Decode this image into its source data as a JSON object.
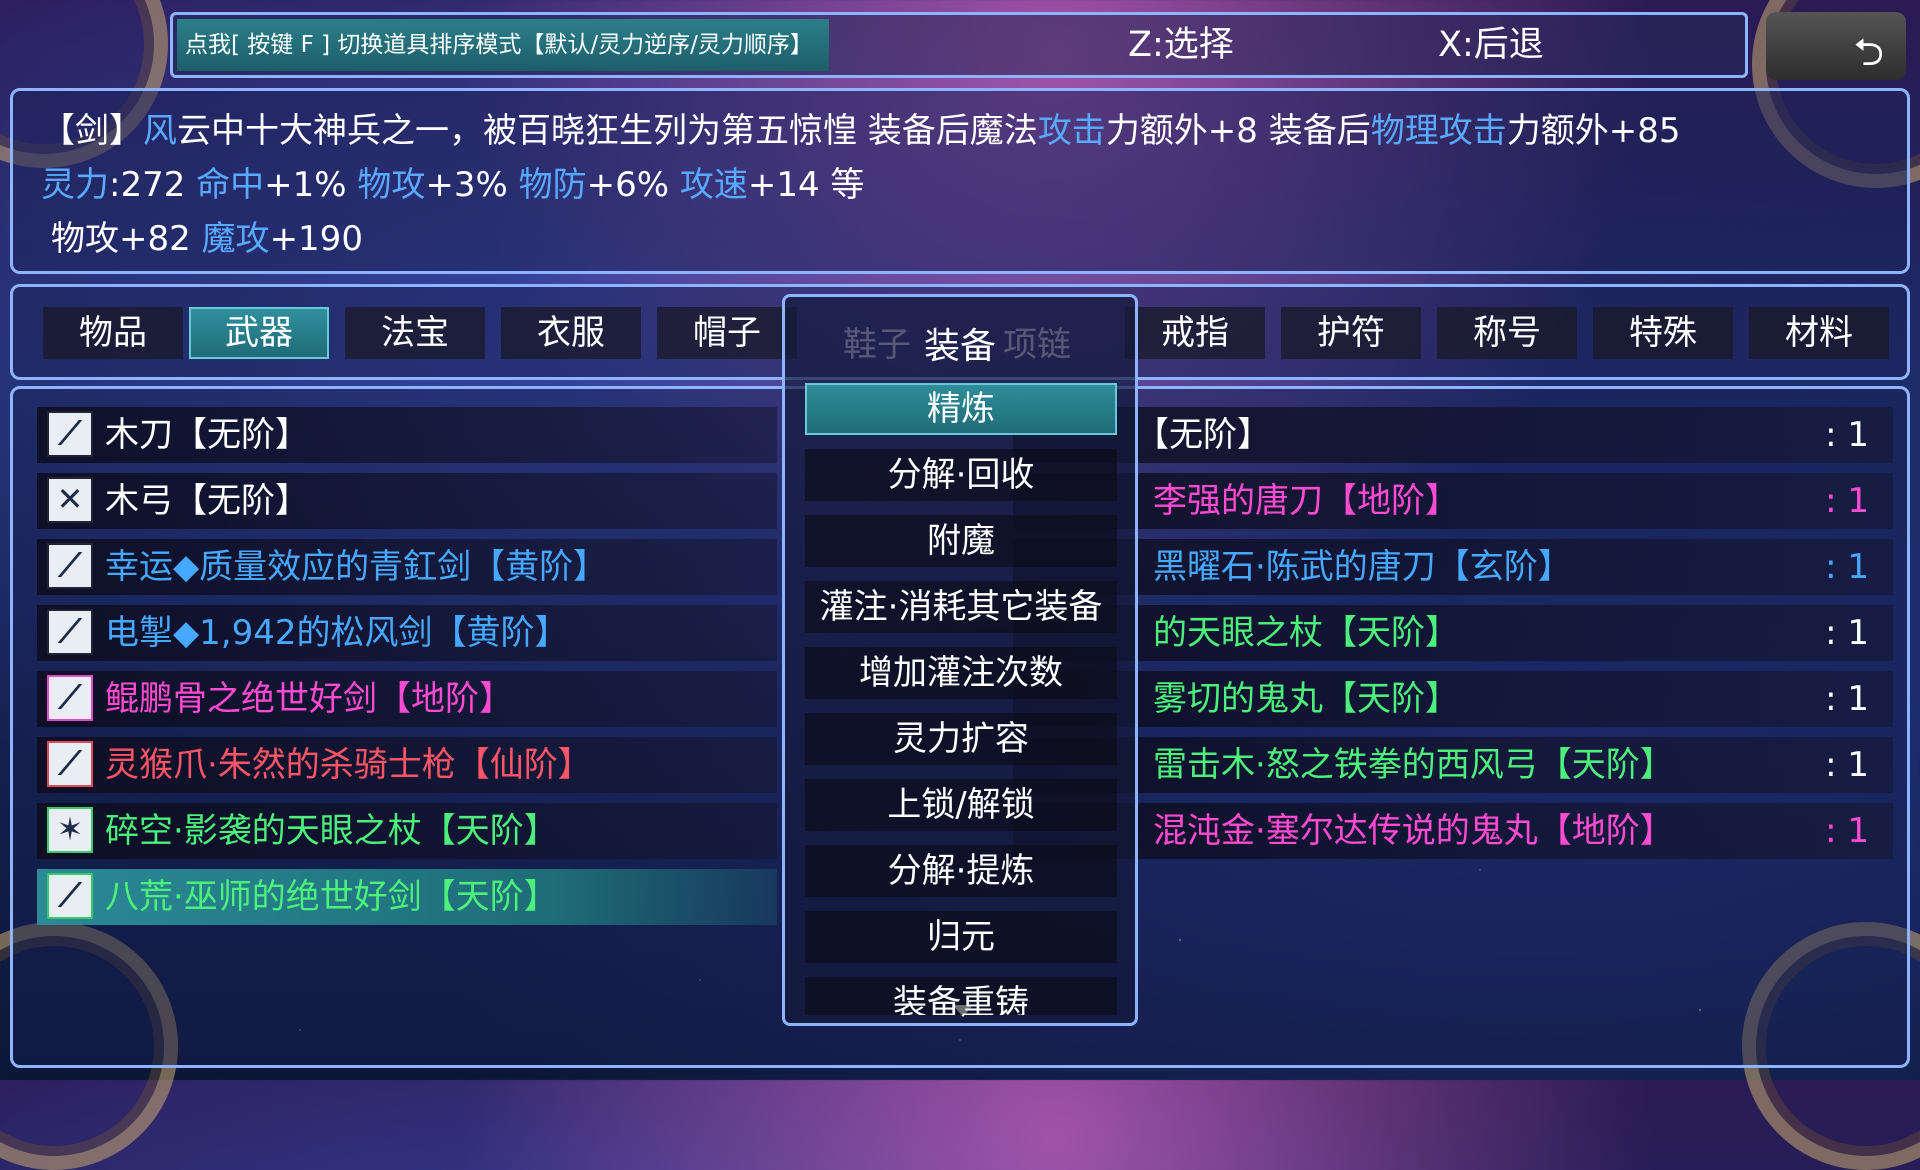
{
  "topbar": {
    "sort_button": "点我[ 按键 F ] 切换道具排序模式【默认/灵力逆序/灵力顺序】",
    "hint_select": "Z:选择",
    "hint_back": "X:后退"
  },
  "back_button_icon": "undo-arrow-icon",
  "description": {
    "line1": [
      {
        "text": "【剑】",
        "c": "white"
      },
      {
        "text": "风",
        "c": "blue"
      },
      {
        "text": "云中十大神兵之一，被百晓狂生列为第五惊惶 装备后魔法",
        "c": "white"
      },
      {
        "text": "攻击",
        "c": "blue"
      },
      {
        "text": "力额外+8 装备后",
        "c": "white"
      },
      {
        "text": "物理攻击",
        "c": "blue"
      },
      {
        "text": "力额外+85",
        "c": "white"
      }
    ],
    "line2": [
      {
        "text": "灵力",
        "c": "blue"
      },
      {
        "text": ":272 ",
        "c": "white"
      },
      {
        "text": "命中",
        "c": "blue"
      },
      {
        "text": "+1% ",
        "c": "white"
      },
      {
        "text": "物攻",
        "c": "blue"
      },
      {
        "text": "+3% ",
        "c": "white"
      },
      {
        "text": "物防",
        "c": "blue"
      },
      {
        "text": "+6% ",
        "c": "white"
      },
      {
        "text": "攻速",
        "c": "blue"
      },
      {
        "text": "+14 等",
        "c": "white"
      }
    ],
    "line3": [
      {
        "text": "物攻+82 ",
        "c": "white"
      },
      {
        "text": "魔攻",
        "c": "blue"
      },
      {
        "text": "+190",
        "c": "white"
      }
    ]
  },
  "tabs": [
    "物品",
    "武器",
    "法宝",
    "衣服",
    "帽子",
    "鞋子",
    "项链",
    "戒指",
    "护符",
    "称号",
    "特殊",
    "材料"
  ],
  "active_tab": "武器",
  "items_left": [
    {
      "name": "木刀【无阶】",
      "color": "white",
      "icon": "sword-icon"
    },
    {
      "name": "木弓【无阶】",
      "color": "white",
      "icon": "bow-icon"
    },
    {
      "name": "幸运◆质量效应的青釭剑【黄阶】",
      "color": "blue",
      "icon": "sword-icon"
    },
    {
      "name": "电掣◆1,942的松风剑【黄阶】",
      "color": "blue",
      "icon": "sword-icon"
    },
    {
      "name": "鲲鹏骨之绝世好剑【地阶】",
      "color": "pink",
      "icon": "sword-icon"
    },
    {
      "name": "灵猴爪·朱然的杀骑士枪【仙阶】",
      "color": "red",
      "icon": "spear-icon"
    },
    {
      "name": "碎空·影袭的天眼之杖【天阶】",
      "color": "green",
      "icon": "staff-icon"
    },
    {
      "name": "八荒·巫师的绝世好剑【天阶】",
      "color": "green",
      "icon": "sword-icon"
    }
  ],
  "items_right": [
    {
      "name": "【无阶】",
      "color": "white",
      "count": ": 1"
    },
    {
      "name": "李强的唐刀【地阶】",
      "color": "pink",
      "count": ": 1"
    },
    {
      "name": "黑曜石·陈武的唐刀【玄阶】",
      "color": "blue",
      "count": ": 1"
    },
    {
      "name": "的天眼之杖【天阶】",
      "color": "green",
      "count": ": 1"
    },
    {
      "name": "雾切的鬼丸【天阶】",
      "color": "green",
      "count": ": 1"
    },
    {
      "name": "雷击木·怒之铁拳的西风弓【天阶】",
      "color": "green",
      "count": ": 1"
    },
    {
      "name": "混沌金·塞尔达传说的鬼丸【地阶】",
      "color": "pink",
      "count": ": 1"
    }
  ],
  "menu": {
    "title": "装备",
    "ghost_left": "鞋子",
    "ghost_right": "项链",
    "items": [
      "精炼",
      "分解·回收",
      "附魔",
      "灌注·消耗其它装备",
      "增加灌注次数",
      "灵力扩容",
      "上锁/解锁",
      "分解·提炼",
      "归元",
      "装备重铸"
    ],
    "selected": "精炼"
  },
  "colors": {
    "accent_blue": "#46a8ff",
    "pink": "#ff4ad2",
    "red": "#ff5566",
    "green": "#4cf07a",
    "teal": "#2a8a96",
    "border": "#8fb4ff"
  }
}
